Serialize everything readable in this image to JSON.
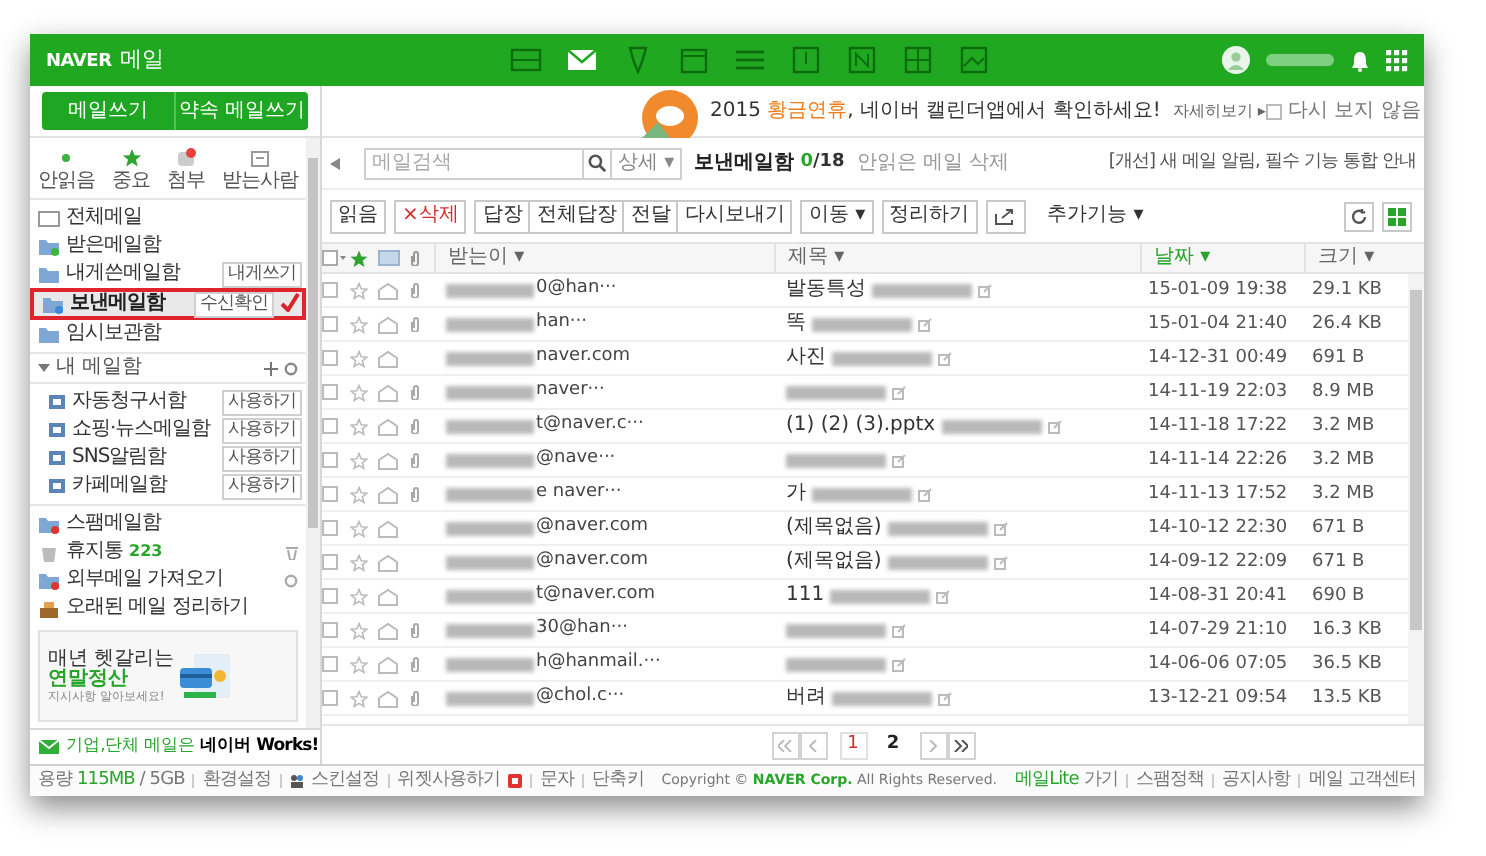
{
  "header": {
    "logo": "NAVER",
    "title": "메일",
    "apps": [
      {
        "selected": false
      },
      {
        "selected": true
      },
      {
        "selected": false
      },
      {
        "selected": false
      },
      {
        "selected": false
      },
      {
        "selected": false
      },
      {
        "selected": false
      },
      {
        "selected": false
      },
      {
        "selected": false
      }
    ]
  },
  "sidebar": {
    "buttons": [
      "메일쓰기",
      "약속 메일쓰기"
    ],
    "quick": [
      {
        "label": "안읽음"
      },
      {
        "label": "중요"
      },
      {
        "label": "첨부"
      },
      {
        "label": "받는사람"
      }
    ],
    "folders": [
      {
        "label": "전체메일",
        "selected": false,
        "highlighted": false
      },
      {
        "label": "받은메일함",
        "selected": false,
        "highlighted": false
      },
      {
        "label": "내게쓴메일함",
        "action": "내게쓰기",
        "selected": false,
        "highlighted": false
      },
      {
        "label": "보낸메일함",
        "action": "수신확인",
        "selected": true,
        "highlighted": true
      },
      {
        "label": "임시보관함",
        "selected": false,
        "highlighted": false
      }
    ],
    "my_folders": {
      "label": "내 메일함",
      "expanded": true,
      "children": [
        {
          "label": "자동청구서함",
          "action": "사용하기"
        },
        {
          "label": "쇼핑·뉴스메일함",
          "action": "사용하기"
        },
        {
          "label": "SNS알림함",
          "action": "사용하기"
        },
        {
          "label": "카페메일함",
          "action": "사용하기"
        }
      ]
    },
    "extra": [
      {
        "label": "스팸메일함",
        "kind": "spam"
      },
      {
        "label": "휴지통",
        "count": "223",
        "kind": "trash"
      },
      {
        "label": "외부메일 가져오기",
        "kind": "external"
      },
      {
        "label": "오래된 메일 정리하기",
        "kind": "cleanup"
      }
    ],
    "ad": {
      "line_1": "매년 헷갈리는",
      "line_2": "연말정산",
      "line_3": "지시사항 알아보세요!"
    },
    "works": "기업,단체 메일은 **네이버 Works!**"
  },
  "banner": {
    "text": "2015 **황금연휴**, 네이버 캘린더앱에서 확인하세요!",
    "more": "자세히보기 ▸",
    "dismiss": {
      "label": "다시 보지 않음",
      "checked": false
    }
  },
  "search": {
    "placeholder": "메일검색",
    "detail": "상세 ▾"
  },
  "folder_title": "보낸메일함",
  "unread": "0",
  "total": "/18",
  "delete_unread": "안읽은 메일 삭제",
  "notice": "[개선] 새 메일 알림, 필수 기능 통합 안내",
  "toolbar": [
    [
      {
        "label": "읽음",
        "kind": "text"
      }
    ],
    [
      {
        "label": "×삭제",
        "kind": "delete"
      }
    ],
    [
      {
        "label": "답장",
        "kind": "text"
      },
      {
        "label": "전체답장",
        "kind": "text"
      },
      {
        "label": "전달",
        "kind": "text"
      },
      {
        "label": "다시보내기",
        "kind": "text"
      }
    ],
    [
      {
        "label": "이동 ▾",
        "kind": "text"
      }
    ],
    [
      {
        "label": "정리하기",
        "kind": "text"
      }
    ],
    [
      {
        "kind": "share"
      }
    ],
    [
      {
        "label": "추가기능 ▾",
        "kind": "plain"
      }
    ]
  ],
  "columns": [
    {
      "label": "받는이 ▾",
      "sorted": false
    },
    {
      "label": "제목 ▾",
      "sorted": false
    },
    {
      "label": "날짜 ▾",
      "sorted": true
    },
    {
      "label": "크기 ▾",
      "sorted": false
    }
  ],
  "rows": [
    {
      "sender": "0@han···",
      "subject": "발동특성",
      "date": "15-01-09 19:38",
      "size": "29.1 KB",
      "attachment": true,
      "checked": false
    },
    {
      "sender": "han···",
      "subject": "똑",
      "date": "15-01-04 21:40",
      "size": "26.4 KB",
      "attachment": true,
      "checked": false
    },
    {
      "sender": "naver.com",
      "subject": "사진",
      "date": "14-12-31 00:49",
      "size": "691 B",
      "attachment": false,
      "checked": false
    },
    {
      "sender": "naver···",
      "subject": "",
      "date": "14-11-19 22:03",
      "size": "8.9 MB",
      "attachment": true,
      "checked": false
    },
    {
      "sender": "t@naver.c···",
      "subject": "(1) (2) (3).pptx",
      "date": "14-11-18 17:22",
      "size": "3.2 MB",
      "attachment": true,
      "checked": false
    },
    {
      "sender": "@nave···",
      "subject": "",
      "date": "14-11-14 22:26",
      "size": "3.2 MB",
      "attachment": true,
      "checked": false
    },
    {
      "sender": "e naver···",
      "subject": "가",
      "date": "14-11-13 17:52",
      "size": "3.2 MB",
      "attachment": true,
      "checked": false
    },
    {
      "sender": "@naver.com",
      "subject": "(제목없음)",
      "date": "14-10-12 22:30",
      "size": "671 B",
      "attachment": false,
      "checked": false
    },
    {
      "sender": "@naver.com",
      "subject": "(제목없음)",
      "date": "14-09-12 22:09",
      "size": "671 B",
      "attachment": false,
      "checked": false
    },
    {
      "sender": "t@naver.com",
      "subject": "111",
      "date": "14-08-31 20:41",
      "size": "690 B",
      "attachment": false,
      "checked": false
    },
    {
      "sender": "30@han···",
      "subject": "",
      "date": "14-07-29 21:10",
      "size": "16.3 KB",
      "attachment": true,
      "checked": false
    },
    {
      "sender": "h@hanmail.···",
      "subject": "",
      "date": "14-06-06 07:05",
      "size": "36.5 KB",
      "attachment": true,
      "checked": false
    },
    {
      "sender": "@chol.c···",
      "subject": "버려",
      "date": "13-12-21 09:54",
      "size": "13.5 KB",
      "attachment": true,
      "checked": false
    }
  ],
  "pagination": [
    {
      "label": "1",
      "selected": true
    },
    {
      "label": "2",
      "selected": false
    }
  ],
  "footer": {
    "left": [
      "용량 **115MB** / 5GB",
      "환경설정",
      "스킨설정",
      "위젯사용하기",
      "문자",
      "단축키"
    ],
    "copyright": "Copyright © **NAVER Corp.** All Rights Reserved.",
    "right": [
      "**메일Lite** 가기",
      "스팸정책",
      "공지사항",
      "메일 고객센터"
    ]
  }
}
